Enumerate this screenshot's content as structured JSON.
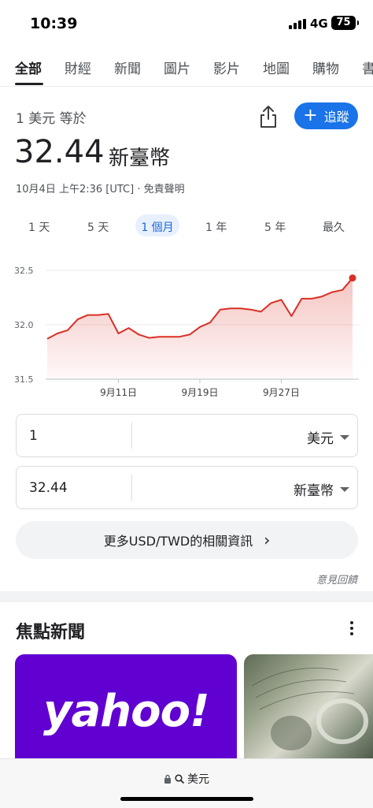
{
  "status": {
    "time": "10:39",
    "network": "4G",
    "battery": "75"
  },
  "tabs": [
    "全部",
    "財經",
    "新聞",
    "圖片",
    "影片",
    "地圖",
    "購物",
    "書"
  ],
  "converter": {
    "header": "1 美元 等於",
    "rate": "32.44",
    "unit": "新臺幣",
    "timestamp": "10月4日 上午2:36 [UTC] · ",
    "disclaimer": "免責聲明",
    "follow_label": "追蹤",
    "ranges": [
      "1 天",
      "5 天",
      "1 個月",
      "1 年",
      "5 年",
      "最久"
    ],
    "active_range": "1 個月",
    "from_value": "1",
    "from_currency": "美元",
    "to_value": "32.44",
    "to_currency": "新臺幣",
    "more_label": "更多USD/TWD的相關資訊",
    "feedback": "意見回饋"
  },
  "chart_data": {
    "type": "area",
    "x": [
      "9月4日",
      "9月5日",
      "9月6日",
      "9月7日",
      "9月8日",
      "9月9日",
      "9月10日",
      "9月11日",
      "9月12日",
      "9月13日",
      "9月14日",
      "9月15日",
      "9月16日",
      "9月17日",
      "9月18日",
      "9月19日",
      "9月20日",
      "9月21日",
      "9月22日",
      "9月23日",
      "9月24日",
      "9月25日",
      "9月26日",
      "9月27日",
      "9月28日",
      "9月29日",
      "9月30日",
      "10月1日",
      "10月2日",
      "10月3日",
      "10月4日"
    ],
    "values": [
      31.87,
      31.92,
      31.95,
      32.05,
      32.09,
      32.09,
      32.1,
      31.92,
      31.97,
      31.91,
      31.88,
      31.89,
      31.89,
      31.89,
      31.91,
      31.98,
      32.02,
      32.14,
      32.15,
      32.15,
      32.14,
      32.12,
      32.2,
      32.23,
      32.08,
      32.24,
      32.24,
      32.26,
      32.3,
      32.32,
      32.43
    ],
    "ylim": [
      31.5,
      32.5
    ],
    "yticks": [
      "32.5",
      "32.0",
      "31.5"
    ],
    "xticks": [
      "9月11日",
      "9月19日",
      "9月27日"
    ],
    "color": "#d93025",
    "grid": true
  },
  "news": {
    "title": "焦點新聞",
    "card1_logo": "yahoo!"
  },
  "bottom": {
    "address": "美元"
  }
}
